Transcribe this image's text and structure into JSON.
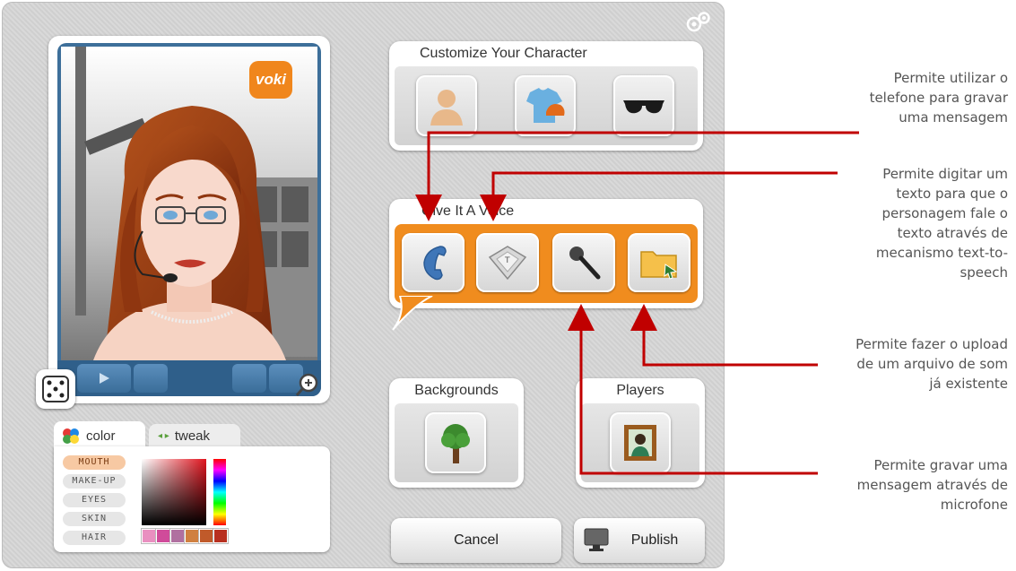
{
  "customize": {
    "title": "Customize Your Character",
    "items": [
      "head",
      "clothing",
      "accessories"
    ]
  },
  "voice": {
    "title": "Give It A Voice",
    "items": [
      "phone",
      "keyboard",
      "microphone",
      "upload-folder"
    ]
  },
  "backgrounds": {
    "title": "Backgrounds"
  },
  "players": {
    "title": "Players"
  },
  "buttons": {
    "cancel": "Cancel",
    "publish": "Publish"
  },
  "brand": {
    "logo": "voki"
  },
  "editor": {
    "tabs": {
      "color": "color",
      "tweak": "tweak"
    },
    "features": [
      "MOUTH",
      "MAKE-UP",
      "EYES",
      "SKIN",
      "HAIR"
    ],
    "active_feature": "MOUTH",
    "swatches": [
      "#e98fc0",
      "#d04b9a",
      "#b070a0",
      "#d08040",
      "#c05a2a",
      "#b83020"
    ]
  },
  "annotations": {
    "phone": "Permite utilizar o telefone para gravar uma mensagem",
    "text": "Permite digitar um texto para que o personagem fale o texto através de mecanismo text-to-speech",
    "upload": "Permite fazer o upload de um arquivo de som já existente",
    "mic": "Permite gravar uma mensagem através de microfone"
  },
  "colors": {
    "arrow": "#c00000",
    "voice_orange": "#f08c1e",
    "frame_blue": "#3d6f9a"
  }
}
